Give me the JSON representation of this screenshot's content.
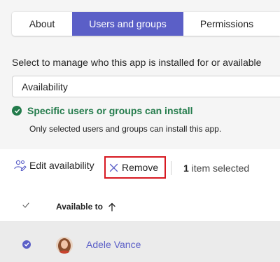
{
  "tabs": [
    {
      "label": "About",
      "active": false
    },
    {
      "label": "Users and groups",
      "active": true
    },
    {
      "label": "Permissions",
      "active": false
    }
  ],
  "description": "Select to manage who this app is installed for or available",
  "availability_dropdown": {
    "value": "Availability"
  },
  "status": {
    "title": "Specific users or groups can install",
    "subtitle": "Only selected users and groups can install this app.",
    "color": "#237b4b"
  },
  "toolbar": {
    "edit_label": "Edit availability",
    "remove_label": "Remove",
    "selected_count": "1",
    "selected_suffix": " item selected",
    "edit_icon": "people-edit-icon",
    "remove_icon": "close-icon"
  },
  "table": {
    "column_header": "Available to",
    "sort_icon": "arrow-up-icon",
    "rows": [
      {
        "name": "Adele Vance",
        "selected": true
      }
    ]
  },
  "colors": {
    "accent": "#5b5fc7",
    "highlight_border": "#d71921"
  }
}
